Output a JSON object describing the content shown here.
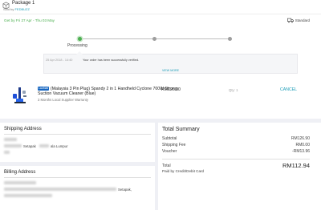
{
  "package": {
    "title": "Package 1",
    "sold_by_prefix": "Sold by",
    "seller": "FEDBUZZ",
    "delivery_estimate": "Get by Fri 27 Apr - Thu 03 May",
    "shipping_method": "Standard",
    "timeline": {
      "current_label": "Processing",
      "steps": 3,
      "active_step": 1
    },
    "status": {
      "time": "25 Apr 2018 - 14:40",
      "message": "Your order has been successfully verified.",
      "view_more": "VIEW MORE"
    },
    "item": {
      "badge": "LazMall",
      "name": "(Malaysia 3 Pin Plug) Spandy 2 in 1 Handheld Cyclone 700W Strong Suction Vacuum Cleaner (Blue)",
      "warranty": "3 Months Local Supplier Warranty",
      "price": "RM126.90",
      "qty": "Qty: 1",
      "cancel_label": "CANCEL"
    }
  },
  "shipping_address": {
    "title": "Shipping Address",
    "visible_fragment_1": "Setapak",
    "visible_fragment_2": "ala Lumpur"
  },
  "billing_address": {
    "title": "Billing Address",
    "visible_fragment": "Setapak,"
  },
  "summary": {
    "title": "Total Summary",
    "rows": [
      {
        "label": "Subtotal",
        "value": "RM126.90"
      },
      {
        "label": "Shipping Fee",
        "value": "RM0.00"
      },
      {
        "label": "Voucher",
        "value": "-RM13.96"
      }
    ],
    "total_label": "Total",
    "total_value": "RM112.94",
    "paid_by": "Paid by Credit/Debit Card"
  },
  "colors": {
    "accent": "#1a9cb7",
    "success": "#4caf50",
    "badge": "#1565c0",
    "background": "#eff0f5"
  }
}
